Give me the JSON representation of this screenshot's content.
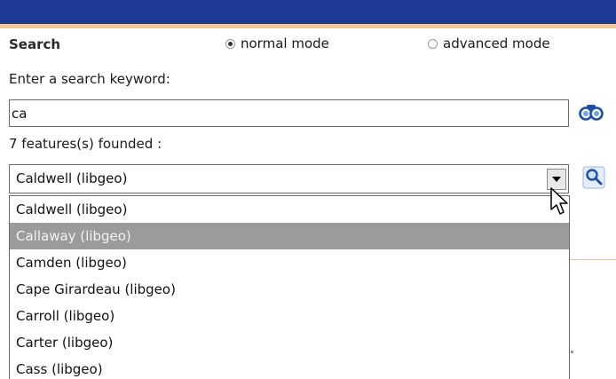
{
  "panel": {
    "title": "Search",
    "modes": [
      {
        "label": "normal mode",
        "checked": true
      },
      {
        "label": "advanced mode",
        "checked": false
      }
    ]
  },
  "search": {
    "prompt": "Enter a search keyword:",
    "value": "ca"
  },
  "results": {
    "count_text": "7 features(s) founded :",
    "selected": "Caldwell (libgeo)",
    "highlighted_index": 1,
    "items": [
      "Caldwell (libgeo)",
      "Callaway (libgeo)",
      "Camden (libgeo)",
      "Cape Girardeau (libgeo)",
      "Carroll (libgeo)",
      "Carter (libgeo)",
      "Cass (libgeo)"
    ]
  },
  "icons": {
    "search_button": "binoculars-icon",
    "zoom_button": "magnifier-icon",
    "dropdown_arrow": "triangle-down-icon",
    "cursor": "mouse-pointer-icon"
  },
  "colors": {
    "header": "#1c3a96",
    "header_accent": "#f1c98c",
    "highlight": "#9b9b9b",
    "icon_blue": "#2c6ed1"
  }
}
